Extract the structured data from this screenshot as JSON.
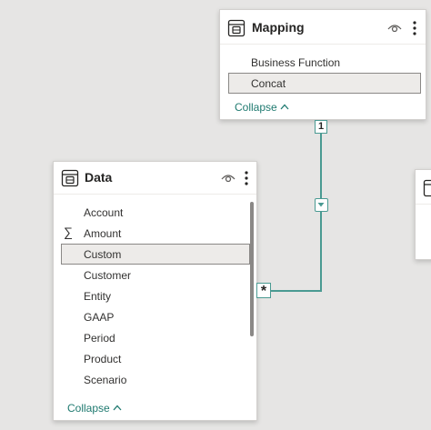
{
  "mapping_table": {
    "title": "Mapping",
    "fields": [
      "Business Function",
      "Concat"
    ],
    "selected_field": "Concat",
    "collapse_label": "Collapse"
  },
  "data_table": {
    "title": "Data",
    "fields": [
      "Account",
      "Amount",
      "Custom",
      "Customer",
      "Entity",
      "GAAP",
      "Period",
      "Product",
      "Scenario"
    ],
    "selected_field": "Custom",
    "sigma_field": "Amount",
    "sigma_symbol": "∑",
    "collapse_label": "Collapse"
  },
  "relationship": {
    "from_cardinality": "1",
    "to_cardinality": "*",
    "cross_filter": "single-direction-down",
    "color": "#4a9a92"
  },
  "icons": [
    "table-icon",
    "eye-icon",
    "more-options-icon",
    "chevron-up-icon",
    "filter-direction-icon"
  ]
}
